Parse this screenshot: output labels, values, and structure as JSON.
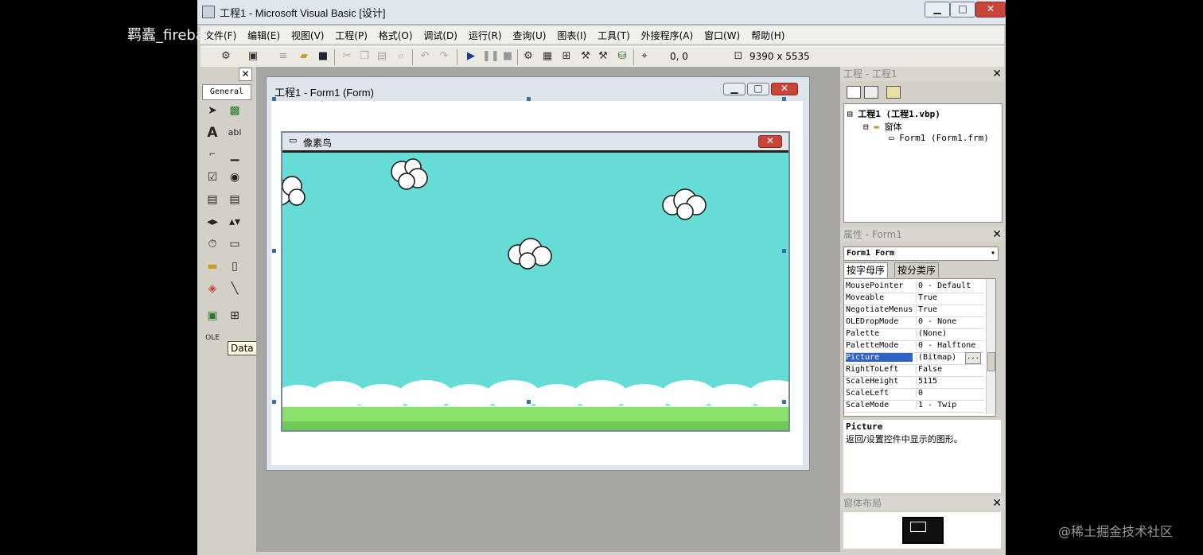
{
  "window": {
    "title": "工程1 - Microsoft Visual Basic [设计]",
    "min_label": "▁",
    "max_label": "□",
    "close_label": "✕"
  },
  "menu": [
    "文件(F)",
    "编辑(E)",
    "视图(V)",
    "工程(P)",
    "格式(O)",
    "调试(D)",
    "运行(R)",
    "查询(U)",
    "图表(I)",
    "工具(T)",
    "外接程序(A)",
    "窗口(W)",
    "帮助(H)"
  ],
  "toolbar": {
    "position": "0, 0",
    "size": "9390 x 5535"
  },
  "toolbox": {
    "close": "✕",
    "tab": "General",
    "tooltip": "Data"
  },
  "designer": {
    "title": "工程1 - Form1 (Form)",
    "inner_title": "像素鸟",
    "inner_close": "✕"
  },
  "project": {
    "title": "工程 - 工程1",
    "close": "✕",
    "root": "工程1 (工程1.vbp)",
    "folder": "窗体",
    "item": "Form1 (Form1.frm)"
  },
  "properties": {
    "title": "属性 - Form1",
    "close": "✕",
    "object": "Form1 Form",
    "tab_alpha": "按字母序",
    "tab_category": "按分类序",
    "rows": [
      {
        "k": "MousePointer",
        "v": "0 - Default"
      },
      {
        "k": "Moveable",
        "v": "True"
      },
      {
        "k": "NegotiateMenus",
        "v": "True"
      },
      {
        "k": "OLEDropMode",
        "v": "0 - None"
      },
      {
        "k": "Palette",
        "v": "(None)"
      },
      {
        "k": "PaletteMode",
        "v": "0 - Halftone"
      },
      {
        "k": "Picture",
        "v": "(Bitmap)"
      },
      {
        "k": "RightToLeft",
        "v": "False"
      },
      {
        "k": "ScaleHeight",
        "v": "5115"
      },
      {
        "k": "ScaleLeft",
        "v": "0"
      },
      {
        "k": "ScaleMode",
        "v": "1 - Twip"
      }
    ],
    "desc_title": "Picture",
    "desc_text": "返回/设置控件中显示的图形。"
  },
  "layout_window": {
    "title": "窗体布局",
    "close": "✕"
  },
  "overlays": {
    "top_left": "羁蠹_firebal",
    "bottom_right": "@稀土掘金技术社区"
  }
}
